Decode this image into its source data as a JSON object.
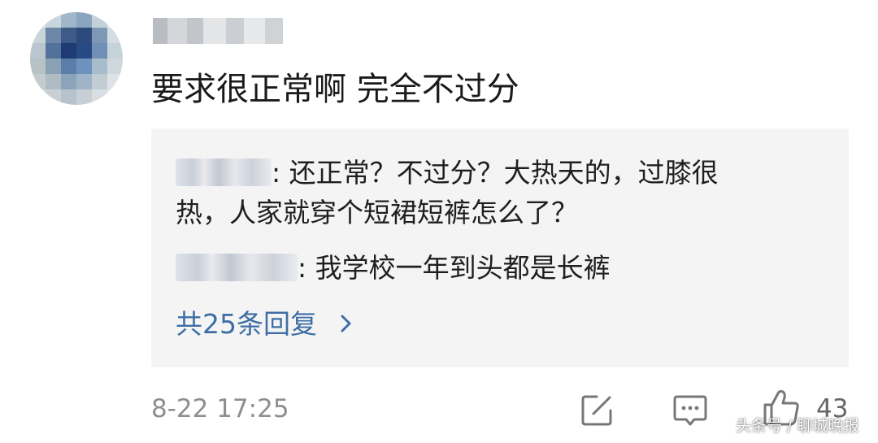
{
  "comment": {
    "text": "要求很正常啊 完全不过分",
    "time": "8-22 17:25",
    "like_count": "43"
  },
  "replies": [
    {
      "text": "还正常？不过分？大热天的，过膝很",
      "text_line2": "热，人家就穿个短裙短裤怎么了？"
    },
    {
      "text": "我学校一年到头都是长裤"
    }
  ],
  "view_more_label": "共25条回复",
  "icons": {
    "view_more": "chevron-right-icon",
    "share": "share-icon",
    "reply": "comment-icon",
    "like": "thumbs-up-icon"
  },
  "watermark": "头条号 / 聊城晚报",
  "colors": {
    "link": "#3e6ea5",
    "reply_background": "#f4f4f4",
    "meta": "#8e8e8e"
  }
}
